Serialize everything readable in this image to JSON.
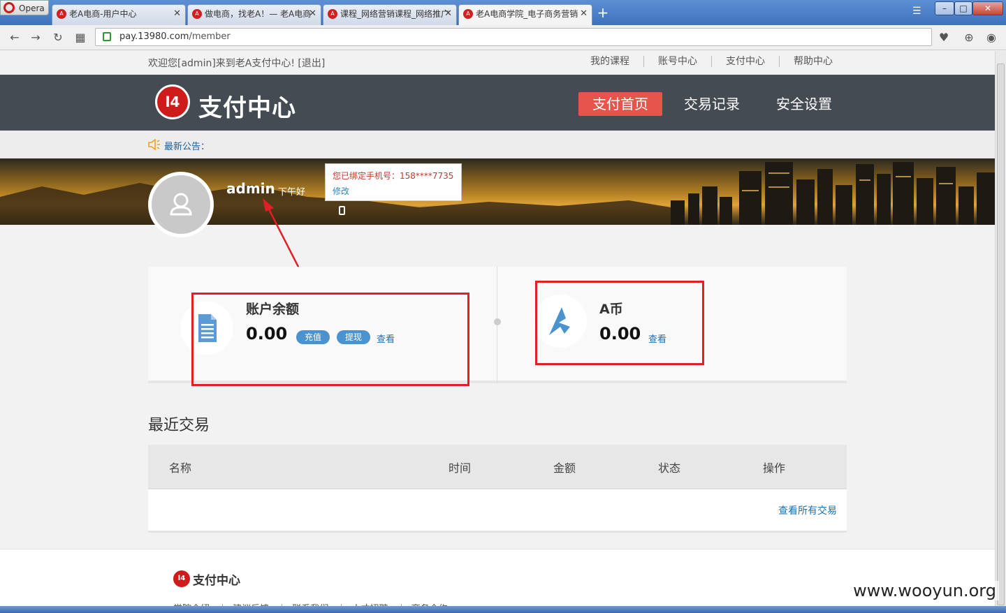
{
  "browser": {
    "opera_label": "Opera",
    "tabs": [
      {
        "title": "老A电商-用户中心",
        "favicon": "A"
      },
      {
        "title": "做电商，找老A！— 老A电商",
        "favicon": "A"
      },
      {
        "title": "课程_网络营销课程_网络推广",
        "favicon": "A"
      },
      {
        "title": "老A电商学院_电子商务营销",
        "favicon": "A"
      }
    ],
    "new_tab": "+",
    "url_host": "pay.13980.com",
    "url_path": "/member",
    "win_min": "–",
    "win_max": "□",
    "win_close": "✕"
  },
  "topbar": {
    "welcome": "欢迎您[admin]来到老A支付中心!  [退出]",
    "links": [
      "我的课程",
      "账号中心",
      "支付中心",
      "帮助中心"
    ]
  },
  "header": {
    "logo_mark": "l4",
    "logo_text": "支付中心",
    "nav": [
      {
        "label": "支付首页",
        "active": true
      },
      {
        "label": "交易记录",
        "active": false
      },
      {
        "label": "安全设置",
        "active": false
      }
    ]
  },
  "notice": {
    "label": "最新公告："
  },
  "profile": {
    "username": "admin",
    "greeting": "下午好",
    "tooltip_phone": "您已绑定手机号：158****7735",
    "tooltip_edit": "修改"
  },
  "cards": {
    "balance": {
      "title": "账户余额",
      "amount": "0.00",
      "recharge": "充值",
      "withdraw": "提现",
      "view": "查看"
    },
    "acoin": {
      "title": "A币",
      "amount": "0.00",
      "view": "查看"
    }
  },
  "recent": {
    "title": "最近交易",
    "columns": [
      "名称",
      "时间",
      "金额",
      "状态",
      "操作"
    ],
    "view_all": "查看所有交易"
  },
  "footer": {
    "logo_mark": "l4",
    "logo_text": "支付中心",
    "links": [
      "学院介绍",
      "建议反馈",
      "联系我们",
      "人才招聘",
      "商务合作"
    ]
  },
  "watermark": "www.wooyun.org",
  "colors": {
    "nav_active": "#e6544c",
    "header_bg": "#444b52",
    "pill": "#4a93cf",
    "annotation_red": "#e01f26"
  }
}
